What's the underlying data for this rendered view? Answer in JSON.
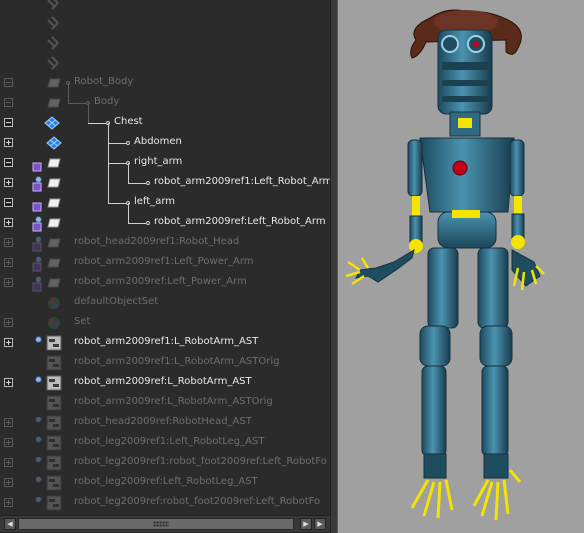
{
  "outliner": {
    "rows": [
      {
        "label": "",
        "dim": true,
        "expander": "none",
        "icon": "joint-icon"
      },
      {
        "label": "",
        "dim": true,
        "expander": "none",
        "icon": "joint-icon"
      },
      {
        "label": "",
        "dim": true,
        "expander": "none",
        "icon": "joint-icon"
      },
      {
        "label": "",
        "dim": true,
        "expander": "none",
        "icon": "joint-icon"
      },
      {
        "label": "Robot_Body",
        "dim": true,
        "expander": "minus",
        "icon": "mesh-icon",
        "badge": false
      },
      {
        "label": "Body",
        "dim": true,
        "expander": "minus",
        "icon": "mesh-icon",
        "badge": false
      },
      {
        "label": "Chest",
        "dim": false,
        "expander": "minus",
        "icon": "nurbs-surface-icon",
        "badge": false
      },
      {
        "label": "Abdomen",
        "dim": false,
        "expander": "plus",
        "icon": "nurbs-surface-icon",
        "badge": false
      },
      {
        "label": "right_arm",
        "dim": false,
        "expander": "minus",
        "icon": "mesh-icon",
        "badge": false
      },
      {
        "label": "robot_arm2009ref1:Left_Robot_Arm",
        "dim": false,
        "expander": "plus",
        "icon": "mesh-icon",
        "badge": true
      },
      {
        "label": "left_arm",
        "dim": false,
        "expander": "minus",
        "icon": "mesh-icon",
        "badge": false
      },
      {
        "label": "robot_arm2009ref:Left_Robot_Arm",
        "dim": false,
        "expander": "plus",
        "icon": "mesh-icon",
        "badge": true
      },
      {
        "label": "robot_head2009ref1:Robot_Head",
        "dim": true,
        "expander": "plus",
        "icon": "mesh-icon",
        "badge": true
      },
      {
        "label": "robot_arm2009ref1:Left_Power_Arm",
        "dim": true,
        "expander": "plus",
        "icon": "mesh-icon",
        "badge": true
      },
      {
        "label": "robot_arm2009ref:Left_Power_Arm",
        "dim": true,
        "expander": "plus",
        "icon": "mesh-icon",
        "badge": true
      },
      {
        "label": "defaultObjectSet",
        "dim": true,
        "expander": "none",
        "icon": "set-icon",
        "badge": false
      },
      {
        "label": "Set",
        "dim": true,
        "expander": "plus",
        "icon": "set-icon",
        "badge": false
      },
      {
        "label": "robot_arm2009ref1:L_RobotArm_AST",
        "dim": false,
        "expander": "plus",
        "icon": "asset-icon",
        "badge": true
      },
      {
        "label": "robot_arm2009ref1:L_RobotArm_ASTOrig",
        "dim": true,
        "expander": "none",
        "icon": "asset-icon",
        "badge": false
      },
      {
        "label": "robot_arm2009ref:L_RobotArm_AST",
        "dim": false,
        "expander": "plus",
        "icon": "asset-icon",
        "badge": true
      },
      {
        "label": "robot_arm2009ref:L_RobotArm_ASTOrig",
        "dim": true,
        "expander": "none",
        "icon": "asset-icon",
        "badge": false
      },
      {
        "label": "robot_head2009ref:RobotHead_AST",
        "dim": true,
        "expander": "plus",
        "icon": "asset-icon",
        "badge": true
      },
      {
        "label": "robot_leg2009ref1:Left_RobotLeg_AST",
        "dim": true,
        "expander": "plus",
        "icon": "asset-icon",
        "badge": true
      },
      {
        "label": "robot_leg2009ref1:robot_foot2009ref:Left_RobotFo",
        "dim": true,
        "expander": "plus",
        "icon": "asset-icon",
        "badge": true
      },
      {
        "label": "robot_leg2009ref:Left_RobotLeg_AST",
        "dim": true,
        "expander": "plus",
        "icon": "asset-icon",
        "badge": true
      },
      {
        "label": "robot_leg2009ref:robot_foot2009ref:Left_RobotFo",
        "dim": true,
        "expander": "plus",
        "icon": "asset-icon",
        "badge": true
      }
    ]
  },
  "scrollbar": {
    "left_icon": "arrow-left-icon",
    "right_icon": "arrow-right-icon",
    "grip_icon": "grip-icon"
  },
  "viewport": {
    "background": "#a0a0a0",
    "subject": "robot-character-model"
  },
  "colors": {
    "outliner_bg": "#2b2b2b",
    "text": "#e8e8e8",
    "text_dim": "#6e6e6e",
    "robot_body": "#3d7a94",
    "robot_joint": "#f4e400",
    "robot_chest_light": "#c4001a",
    "hat": "#5a2a1a"
  }
}
